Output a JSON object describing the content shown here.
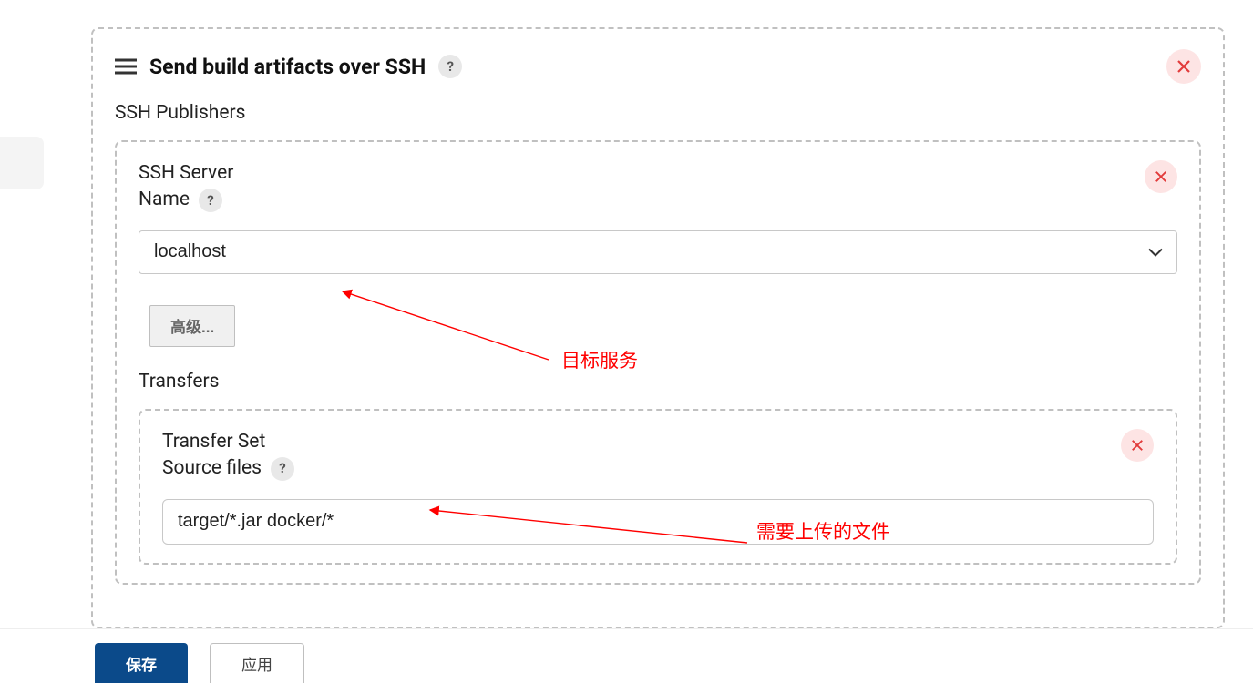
{
  "panel": {
    "title": "Send build artifacts over SSH",
    "publishers_label": "SSH Publishers"
  },
  "ssh_server": {
    "label_line1": "SSH Server",
    "label_line2": "Name",
    "value": "localhost",
    "advanced_label": "高级...",
    "transfers_label": "Transfers"
  },
  "transfer_set": {
    "label_line1": "Transfer Set",
    "label_line2": "Source files",
    "value": "target/*.jar docker/*"
  },
  "footer": {
    "save": "保存",
    "apply": "应用"
  },
  "help": {
    "glyph": "?"
  },
  "annotations": {
    "target_service": "目标服务",
    "upload_files": "需要上传的文件"
  }
}
